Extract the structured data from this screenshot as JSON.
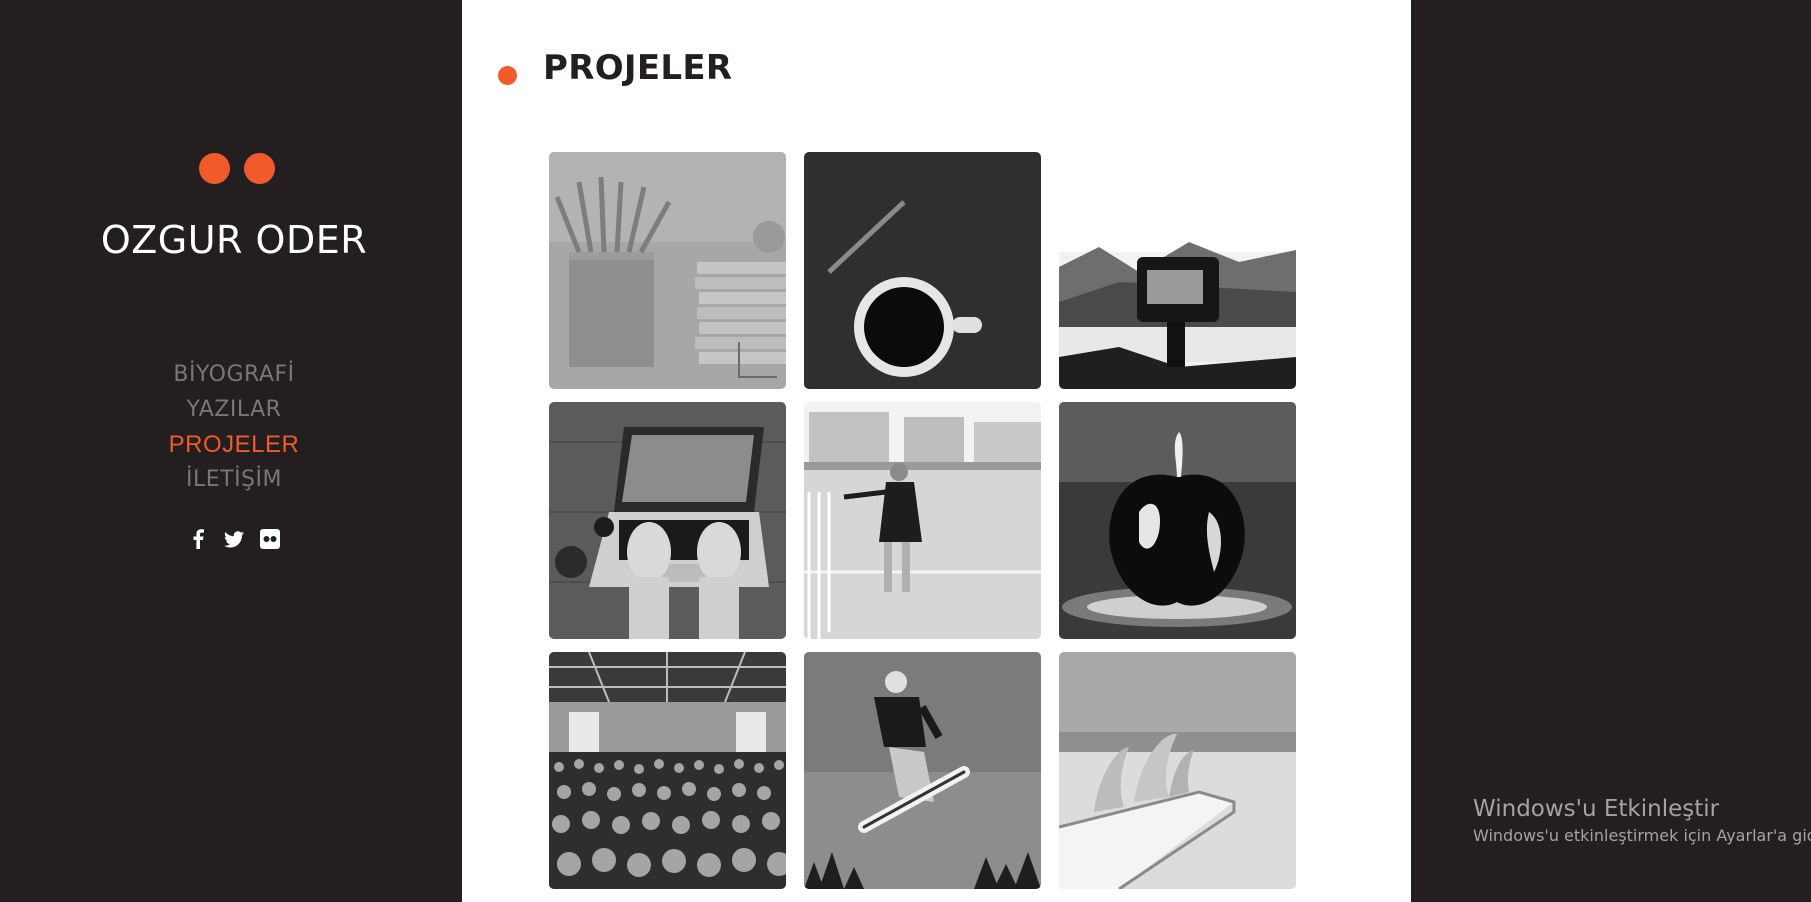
{
  "brand": {
    "name": "OZGUR ODER"
  },
  "nav": {
    "items": [
      {
        "label": "BİYOGRAFİ"
      },
      {
        "label": "YAZILAR"
      },
      {
        "label": "PROJELER",
        "active": true
      },
      {
        "label": "İLETİŞİM"
      }
    ]
  },
  "social": [
    "facebook-icon",
    "twitter-icon",
    "flickr-icon"
  ],
  "page": {
    "title": "PROJELER"
  },
  "gallery": {
    "items": [
      {
        "subject": "pencils-and-books"
      },
      {
        "subject": "pencil-and-coffee"
      },
      {
        "subject": "camera-lake"
      },
      {
        "subject": "laptop-typing"
      },
      {
        "subject": "woman-rooftop"
      },
      {
        "subject": "apple-splash"
      },
      {
        "subject": "conference-crowd"
      },
      {
        "subject": "snowboarder"
      },
      {
        "subject": "surfboard-fins"
      }
    ]
  },
  "windows_activation": {
    "title": "Windows'u Etkinleştir",
    "subtitle": "Windows'u etkinleştirmek için Ayarlar'a gidin"
  },
  "colors": {
    "accent": "#f15a2b",
    "sidebar_bg": "#231f20",
    "main_bg": "#ffffff"
  }
}
